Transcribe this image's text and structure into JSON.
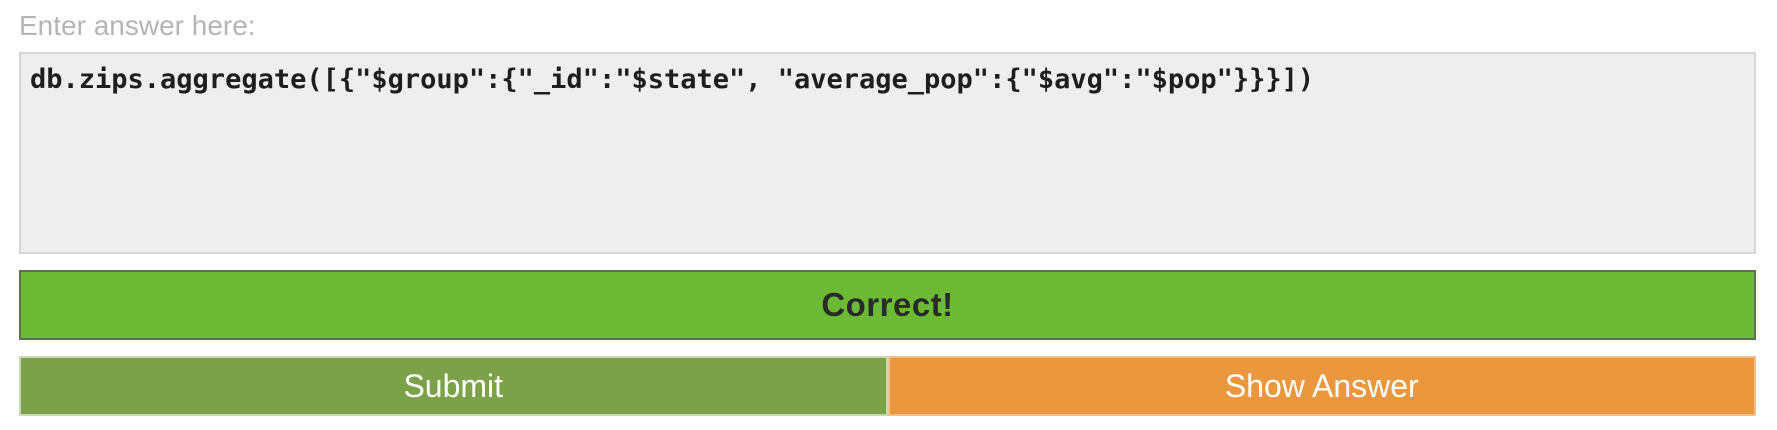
{
  "prompt": {
    "label": "Enter answer here:"
  },
  "answer": {
    "value": "db.zips.aggregate([{\"$group\":{\"_id\":\"$state\", \"average_pop\":{\"$avg\":\"$pop\"}}}])"
  },
  "result": {
    "message": "Correct!",
    "color": "#6cb933"
  },
  "buttons": {
    "submit_label": "Submit",
    "show_answer_label": "Show Answer",
    "submit_color": "#7ba249",
    "show_answer_color": "#ea973e"
  }
}
